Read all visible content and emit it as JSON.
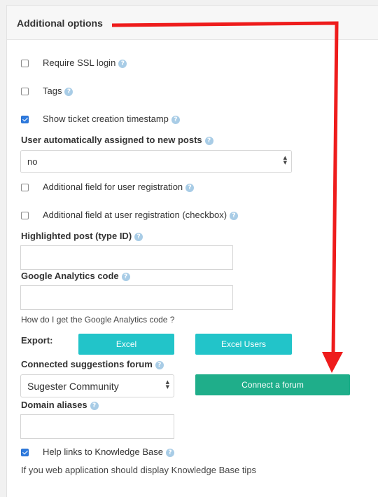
{
  "panel": {
    "title": "Additional options"
  },
  "options": {
    "require_ssl": {
      "label": "Require SSL login",
      "checked": false
    },
    "tags": {
      "label": "Tags",
      "checked": false
    },
    "show_timestamp": {
      "label": "Show ticket creation timestamp",
      "checked": true
    },
    "auto_assign": {
      "label": "User automatically assigned to new posts",
      "value": "no"
    },
    "additional_field": {
      "label": "Additional field for user registration",
      "checked": false
    },
    "additional_field_checkbox": {
      "label": "Additional field at user registration (checkbox)",
      "checked": false
    },
    "highlighted_post": {
      "label": "Highlighted post (type ID)",
      "value": ""
    },
    "google_analytics": {
      "label": "Google Analytics code",
      "value": "",
      "help_text": "How do I get the Google Analytics code ?"
    },
    "export": {
      "label": "Export:",
      "excel_label": "Excel",
      "excel_users_label": "Excel Users"
    },
    "suggestions_forum": {
      "label": "Connected suggestions forum",
      "value": "Sugester Community",
      "connect_label": "Connect a forum"
    },
    "domain_aliases": {
      "label": "Domain aliases",
      "value": ""
    },
    "help_links": {
      "label": "Help links to Knowledge Base",
      "checked": true,
      "note": "If you web application should display Knowledge Base tips"
    }
  },
  "icons": {
    "help": "question-circle-icon",
    "help_glyph": "?"
  },
  "colors": {
    "arrow": "#ee1c1c",
    "checkbox_checked": "#2e7be0",
    "button_cyan": "#22c4c9",
    "button_green": "#1fae8a"
  }
}
